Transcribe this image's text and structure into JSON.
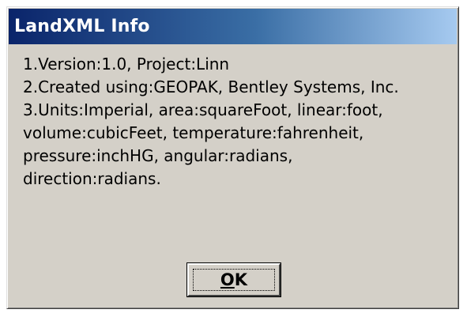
{
  "window": {
    "title": "LandXML Info"
  },
  "info": {
    "lines": [
      "1.Version:1.0, Project:Linn",
      "2.Created using:GEOPAK, Bentley Systems, Inc.",
      "3.Units:Imperial, area:squareFoot, linear:foot,",
      "volume:cubicFeet, temperature:fahrenheit,",
      "pressure:inchHG, angular:radians,",
      "direction:radians."
    ]
  },
  "buttons": {
    "ok": {
      "mnemonic": "O",
      "rest": "K"
    }
  },
  "colors": {
    "title_gradient_start": "#0a246a",
    "title_gradient_end": "#a6caf0",
    "dialog_face": "#d4d0c8",
    "title_text": "#ffffff"
  }
}
